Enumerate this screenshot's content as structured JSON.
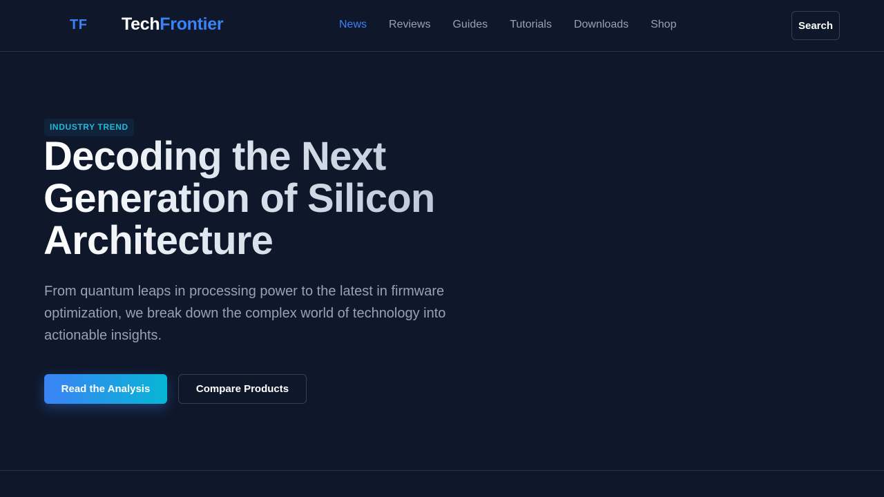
{
  "brand": {
    "mark": "TF",
    "name_part1": "Tech",
    "name_part2": "Frontier"
  },
  "nav": {
    "items": [
      {
        "label": "News",
        "active": true
      },
      {
        "label": "Reviews",
        "active": false
      },
      {
        "label": "Guides",
        "active": false
      },
      {
        "label": "Tutorials",
        "active": false
      },
      {
        "label": "Downloads",
        "active": false
      },
      {
        "label": "Shop",
        "active": false
      }
    ],
    "search_label": "Search"
  },
  "hero": {
    "badge": "INDUSTRY TREND",
    "headline": "Decoding the Next Generation of Silicon Architecture",
    "subtitle": "From quantum leaps in processing power to the latest in firmware optimization, we break down the complex world of technology into actionable insights.",
    "primary_cta": "Read the Analysis",
    "secondary_cta": "Compare Products"
  },
  "colors": {
    "background": "#0f172a",
    "accent": "#3b82f6",
    "accent_secondary": "#06b6d4",
    "muted_text": "#94a3b8"
  }
}
